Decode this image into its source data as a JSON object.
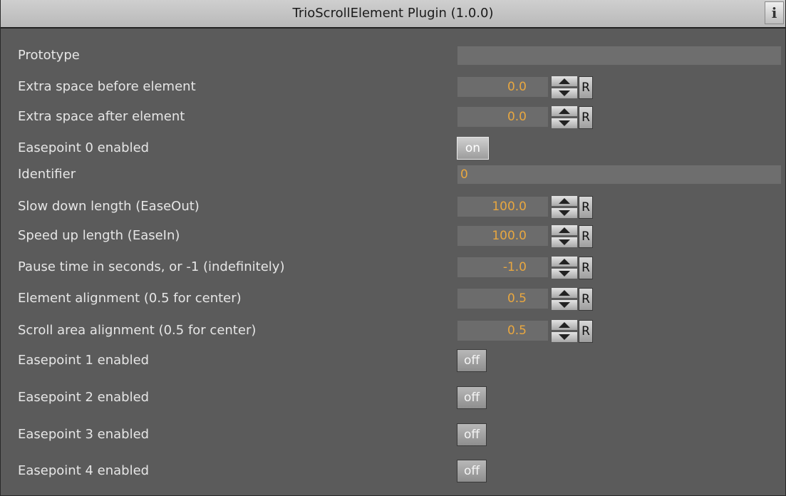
{
  "header": {
    "title": "TrioScrollElement Plugin (1.0.0)",
    "info_label": "i"
  },
  "fields": {
    "prototype": {
      "label": "Prototype",
      "value": ""
    },
    "space_before": {
      "label": "Extra space before element",
      "value": "0.0",
      "reset": "R"
    },
    "space_after": {
      "label": "Extra space after element",
      "value": "0.0",
      "reset": "R"
    },
    "easepoint0": {
      "label": "Easepoint 0 enabled",
      "state": "on"
    },
    "identifier": {
      "label": "Identifier",
      "value": "0"
    },
    "slow_down": {
      "label": "Slow down length (EaseOut)",
      "value": "100.0",
      "reset": "R"
    },
    "speed_up": {
      "label": "Speed up length (EaseIn)",
      "value": "100.0",
      "reset": "R"
    },
    "pause_time": {
      "label": "Pause time in seconds, or -1 (indefinitely)",
      "value": "-1.0",
      "reset": "R"
    },
    "element_alignment": {
      "label": "Element alignment (0.5 for center)",
      "value": "0.5",
      "reset": "R"
    },
    "scroll_alignment": {
      "label": "Scroll area alignment (0.5 for center)",
      "value": "0.5",
      "reset": "R"
    },
    "easepoint1": {
      "label": "Easepoint 1 enabled",
      "state": "off"
    },
    "easepoint2": {
      "label": "Easepoint 2 enabled",
      "state": "off"
    },
    "easepoint3": {
      "label": "Easepoint 3 enabled",
      "state": "off"
    },
    "easepoint4": {
      "label": "Easepoint 4 enabled",
      "state": "off"
    }
  },
  "colors": {
    "panel_bg": "#5b5b5b",
    "value_text": "#e8a740",
    "label_text": "#e6e6e6"
  }
}
